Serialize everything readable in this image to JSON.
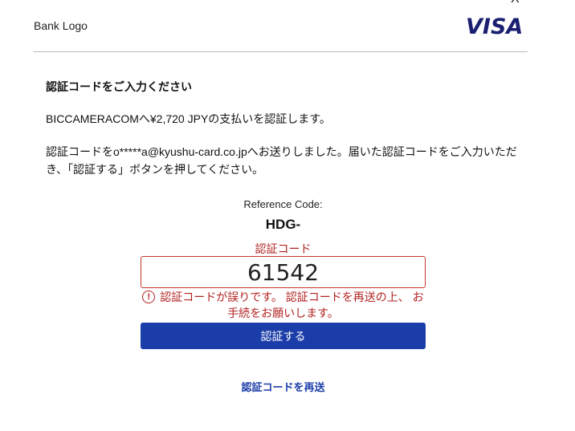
{
  "header": {
    "close_label": "X",
    "bank_logo": "Bank Logo",
    "visa_logo": "VISA"
  },
  "content": {
    "heading": "認証コードをご入力ください",
    "payment_text": "BICCAMERACOMへ¥2,720 JPYの支払いを認証します。",
    "sent_text": "認証コードをo*****a@kyushu-card.co.jpへお送りしました。届いた認証コードをご入力いただき、「認証する」ボタンを押してください。",
    "reference_label": "Reference Code:",
    "reference_value": "HDG-",
    "field_label": "認証コード",
    "code_value": "61542",
    "error_icon": "!",
    "error_line1": "認証コードが誤りです。 認証コードを再送の上、 お",
    "error_line2": "手続をお願いします。",
    "submit_label": "認証する",
    "resend_label": "認証コードを再送"
  },
  "colors": {
    "primary": "#1b3da9",
    "error": "#b22222",
    "visa": "#1a1f71"
  }
}
